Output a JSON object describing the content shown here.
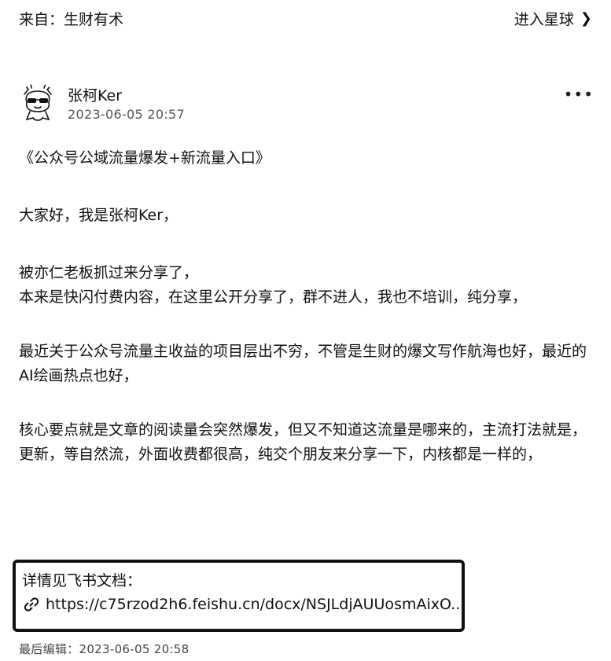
{
  "header": {
    "source_label": "来自：生财有术",
    "enter_label": "进入星球",
    "enter_icon": "chevron-right-icon"
  },
  "post": {
    "author_name": "张柯Ker",
    "timestamp": "2023-06-05 20:57",
    "more_icon": "more-horizontal-icon",
    "title": "《公众号公域流量爆发+新流量入口》",
    "paragraphs": [
      "大家好，我是张柯Ker，",
      "被亦仁老板抓过来分享了，",
      "本来是快闪付费内容，在这里公开分享了，群不进人，我也不培训，纯分享，",
      "最近关于公众号流量主收益的项目层出不穷，不管是生财的爆文写作航海也好，最近的AI绘画热点也好，",
      "核心要点就是文章的阅读量会突然爆发，但又不知道这流量是哪来的，主流打法就是，更新，等自然流，外面收费都很高，纯交个朋友来分享一下，内核都是一样的，"
    ],
    "doc_label": "详情见飞书文档：",
    "doc_link": "https://c75rzod2h6.feishu.cn/docx/NSJLdjAUUosmAixO...",
    "edited": "最后编辑：2023-06-05 20:58"
  }
}
